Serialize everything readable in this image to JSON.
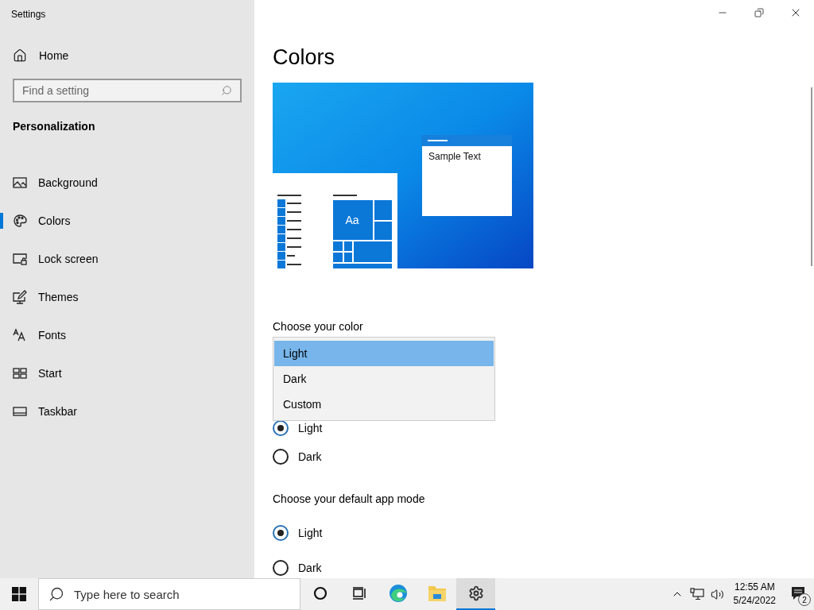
{
  "window": {
    "title": "Settings"
  },
  "sidebar": {
    "home": "Home",
    "search": {
      "placeholder": "Find a setting"
    },
    "section": "Personalization",
    "items": [
      {
        "kind": "background",
        "label": "Background",
        "selected": false
      },
      {
        "kind": "colors",
        "label": "Colors",
        "selected": true
      },
      {
        "kind": "lock",
        "label": "Lock screen",
        "selected": false
      },
      {
        "kind": "themes",
        "label": "Themes",
        "selected": false
      },
      {
        "kind": "fonts",
        "label": "Fonts",
        "selected": false
      },
      {
        "kind": "start",
        "label": "Start",
        "selected": false
      },
      {
        "kind": "taskbar",
        "label": "Taskbar",
        "selected": false
      }
    ]
  },
  "page": {
    "title": "Colors",
    "preview": {
      "sample_text": "Sample Text",
      "tile_text": "Aa"
    },
    "color_label": "Choose your color",
    "color_menu": [
      {
        "label": "Light",
        "selected": true
      },
      {
        "label": "Dark",
        "selected": false
      },
      {
        "label": "Custom",
        "selected": false
      }
    ],
    "windows_mode": [
      {
        "label": "Light",
        "selected": true
      },
      {
        "label": "Dark",
        "selected": false
      }
    ],
    "app_mode_label": "Choose your default app mode",
    "app_mode": [
      {
        "label": "Light",
        "selected": true
      },
      {
        "label": "Dark",
        "selected": false
      }
    ]
  },
  "taskbar": {
    "search": {
      "placeholder": "Type here to search"
    },
    "apps": [
      {
        "kind": "cortana",
        "selected": false
      },
      {
        "kind": "task-view",
        "selected": false
      },
      {
        "kind": "edge",
        "selected": false
      },
      {
        "kind": "explorer",
        "selected": false
      },
      {
        "kind": "settings",
        "selected": true
      }
    ],
    "clock": {
      "time": "12:55 AM",
      "date": "5/24/2022"
    },
    "notifications": "2"
  }
}
